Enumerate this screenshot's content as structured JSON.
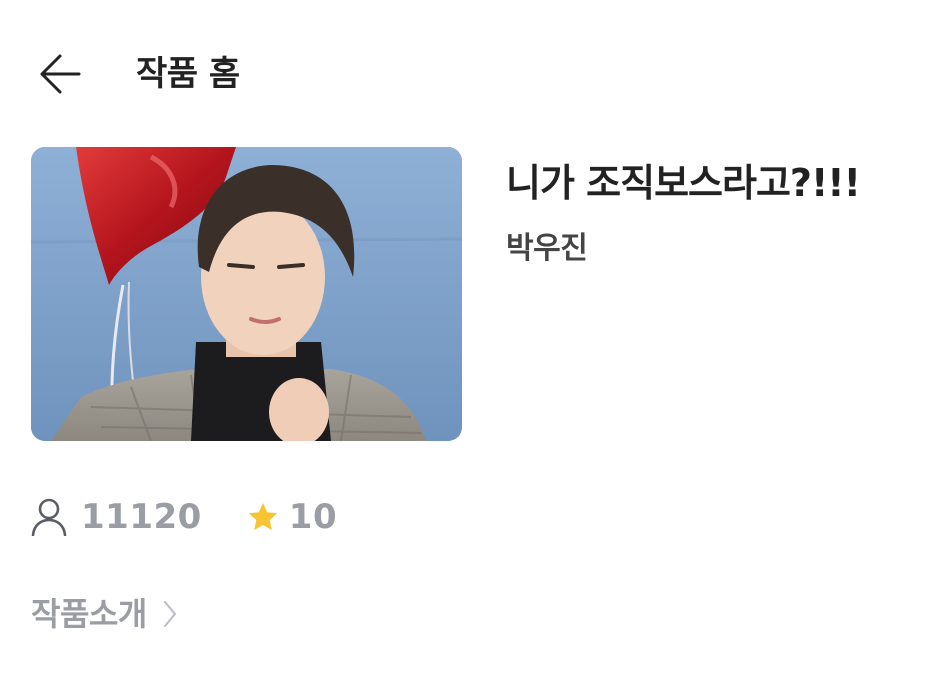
{
  "header": {
    "back_icon": "arrow-left-icon",
    "title": "작품 홈"
  },
  "work": {
    "cover_image": "cover-photo",
    "title": "니가 조직보스라고?!!!",
    "author": "박우진"
  },
  "stats": {
    "views_icon": "person-icon",
    "views": "11120",
    "rating_icon": "star-icon",
    "rating": "10"
  },
  "intro": {
    "label": "작품소개",
    "chevron_icon": "chevron-right-icon"
  },
  "colors": {
    "title_text": "#222222",
    "author_text": "#444444",
    "muted_text": "#9a9da3",
    "star": "#f7c531",
    "background": "#ffffff"
  }
}
